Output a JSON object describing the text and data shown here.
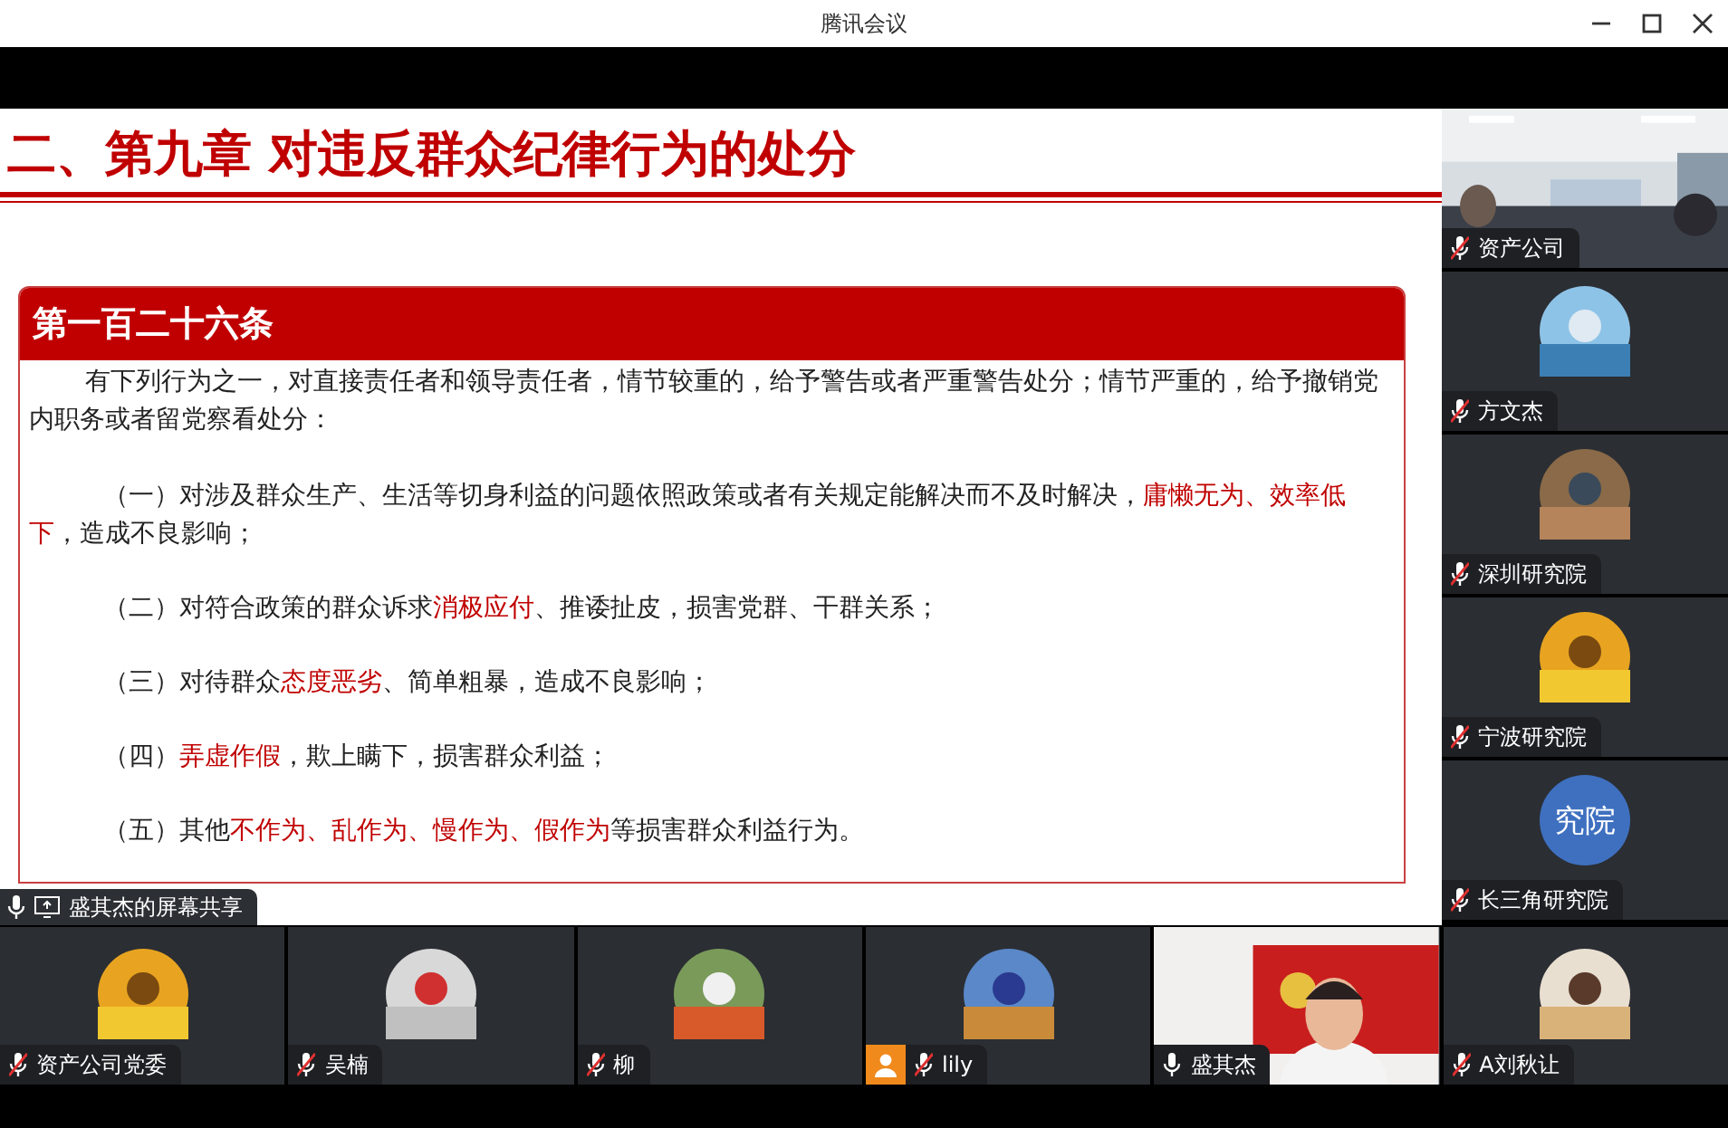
{
  "window": {
    "title": "腾讯会议"
  },
  "slide": {
    "heading": "二、第九章 对违反群众纪律行为的处分",
    "card_title": "第一百二十六条",
    "paragraphs": [
      {
        "kind": "intro",
        "segments": [
          {
            "text": "有下列行为之一，对直接责任者和领导责任者，情节较重的，给予警告或者严重警告处分；情节严重的，给予撤销党内职务或者留党察看处分：",
            "red": false
          }
        ]
      },
      {
        "kind": "item",
        "segments": [
          {
            "text": "（一）对涉及群众生产、生活等切身利益的问题依照政策或者有关规定能解决而不及时解决，",
            "red": false
          },
          {
            "text": "庸懒无为、效率低下",
            "red": true
          },
          {
            "text": "，造成不良影响；",
            "red": false
          }
        ]
      },
      {
        "kind": "item",
        "segments": [
          {
            "text": "（二）对符合政策的群众诉求",
            "red": false
          },
          {
            "text": "消极应付",
            "red": true
          },
          {
            "text": "、推诿扯皮，损害党群、干群关系；",
            "red": false
          }
        ]
      },
      {
        "kind": "item",
        "segments": [
          {
            "text": "（三）对待群众",
            "red": false
          },
          {
            "text": "态度恶劣",
            "red": true
          },
          {
            "text": "、简单粗暴，造成不良影响；",
            "red": false
          }
        ]
      },
      {
        "kind": "item",
        "segments": [
          {
            "text": "（四）",
            "red": false
          },
          {
            "text": "弄虚作假",
            "red": true
          },
          {
            "text": "，欺上瞒下，损害群众利益；",
            "red": false
          }
        ]
      },
      {
        "kind": "item",
        "segments": [
          {
            "text": "（五）其他",
            "red": false
          },
          {
            "text": "不作为、乱作为、慢作为、假作为",
            "red": true
          },
          {
            "text": "等损害群众利益行为。",
            "red": false
          }
        ]
      }
    ]
  },
  "screen_share": {
    "label": "盛其杰的屏幕共享",
    "muted": false
  },
  "side_participants": [
    {
      "name": "资产公司",
      "muted": true,
      "kind": "video"
    },
    {
      "name": "方文杰",
      "muted": true,
      "kind": "avatar"
    },
    {
      "name": "深圳研究院",
      "muted": true,
      "kind": "avatar"
    },
    {
      "name": "宁波研究院",
      "muted": true,
      "kind": "avatar"
    },
    {
      "name": "长三角研究院",
      "muted": true,
      "kind": "initials",
      "initials": "究院"
    }
  ],
  "bottom_participants": [
    {
      "name": "资产公司党委",
      "muted": true,
      "kind": "avatar",
      "host": false
    },
    {
      "name": "吴楠",
      "muted": true,
      "kind": "avatar",
      "host": false
    },
    {
      "name": "柳",
      "muted": true,
      "kind": "avatar",
      "host": false
    },
    {
      "name": "lily",
      "muted": true,
      "kind": "avatar",
      "host": true
    },
    {
      "name": "盛其杰",
      "muted": false,
      "kind": "video",
      "host": false
    },
    {
      "name": "A刘秋让",
      "muted": true,
      "kind": "avatar",
      "host": false
    }
  ]
}
